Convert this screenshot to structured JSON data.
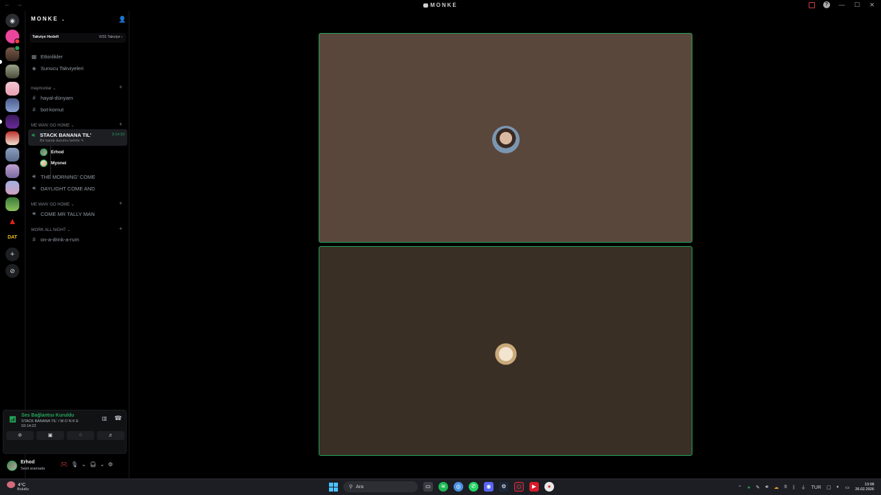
{
  "window": {
    "title": "MONKE",
    "nav": "← →"
  },
  "server": {
    "name": "MONKE",
    "chevron": "⌄",
    "add_member_icon": "👤"
  },
  "boost": {
    "goal_label": "Takviye Hedefi",
    "progress": "0/31 Takviye ›"
  },
  "top_items": [
    {
      "icon": "▦",
      "label": "Etkinlikler"
    },
    {
      "icon": "◈",
      "label": "Sunucu Takviyeleri"
    }
  ],
  "categories": {
    "c1": "maymunlar ⌄",
    "c2": "ME WAN' GO HOME ⌄",
    "c3": "ME WAN' GO HOME ⌄",
    "c4": "WORK ALL NIGHT ⌄"
  },
  "text_channels": {
    "hayal": "hayal-dünyam",
    "bot": "bot-komut",
    "drink": "on-a-drink-a-rum"
  },
  "active_voice": {
    "name": "STACK BANANA TIL'",
    "status": "Bir kanal durumu belirle ✎",
    "timer": "3:14:19"
  },
  "voice_users": [
    {
      "name": "Erhod"
    },
    {
      "name": "Myonei"
    }
  ],
  "voice_channels": {
    "morning": "THE MORNING' COME",
    "daylight": "DAYLIGHT COME AND",
    "tally": "COME MR TALLY MAN"
  },
  "voice_panel": {
    "title": "Ses Bağlantısı Kuruldu",
    "subtitle": "STACK BANANA TIL' / M O N K E",
    "time": "03:14:22"
  },
  "user": {
    "name": "Erhod",
    "status": "Sesli aramada"
  },
  "taskbar": {
    "temp": "4°C",
    "weather": "Bulutlu",
    "search": "Ara",
    "lang": "TUR",
    "time": "13:08",
    "date": "26.02.2026"
  },
  "colors": {
    "speaking": "#23a55a",
    "tile1": "#5a473c",
    "tile2": "#3a2f24",
    "badge": "#f23f43"
  }
}
